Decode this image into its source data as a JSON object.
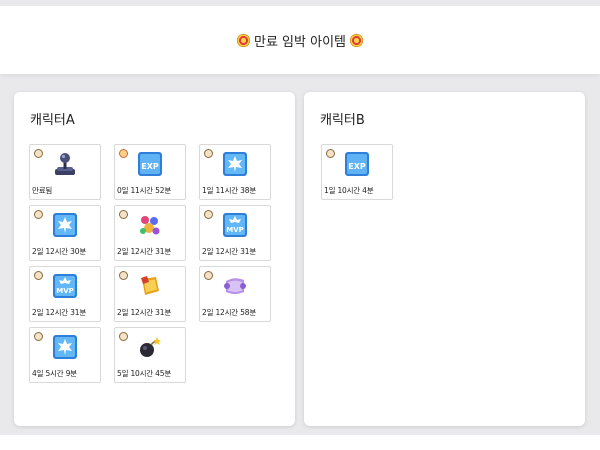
{
  "header": {
    "title": "만료 임박 아이템"
  },
  "panels": {
    "a": {
      "title": "캐릭터A",
      "items": [
        {
          "icon": "joystick-icon",
          "time": "만료됨"
        },
        {
          "icon": "exp-coupon-icon",
          "time": "0일 11시간 52분"
        },
        {
          "icon": "maple-leaf-coupon-icon",
          "time": "1일 11시간 38분"
        },
        {
          "icon": "maple-leaf-coupon-icon",
          "time": "2일 12시간 30분"
        },
        {
          "icon": "potion-bundle-icon",
          "time": "2일 12시간 31분"
        },
        {
          "icon": "mvp-coupon-icon",
          "time": "2일 12시간 31분"
        },
        {
          "icon": "mvp-coupon-icon",
          "time": "2일 12시간 31분"
        },
        {
          "icon": "gold-pouch-icon",
          "time": "2일 12시간 31분"
        },
        {
          "icon": "scroll-icon",
          "time": "2일 12시간 58분"
        },
        {
          "icon": "maple-leaf-coupon-icon",
          "time": "4일 5시간 9분"
        },
        {
          "icon": "star-bomb-icon",
          "time": "5일 10시간 45분"
        }
      ]
    },
    "b": {
      "title": "캐릭터B",
      "items": [
        {
          "icon": "exp-coupon-icon",
          "time": "1일 10시간 4분"
        }
      ]
    }
  }
}
